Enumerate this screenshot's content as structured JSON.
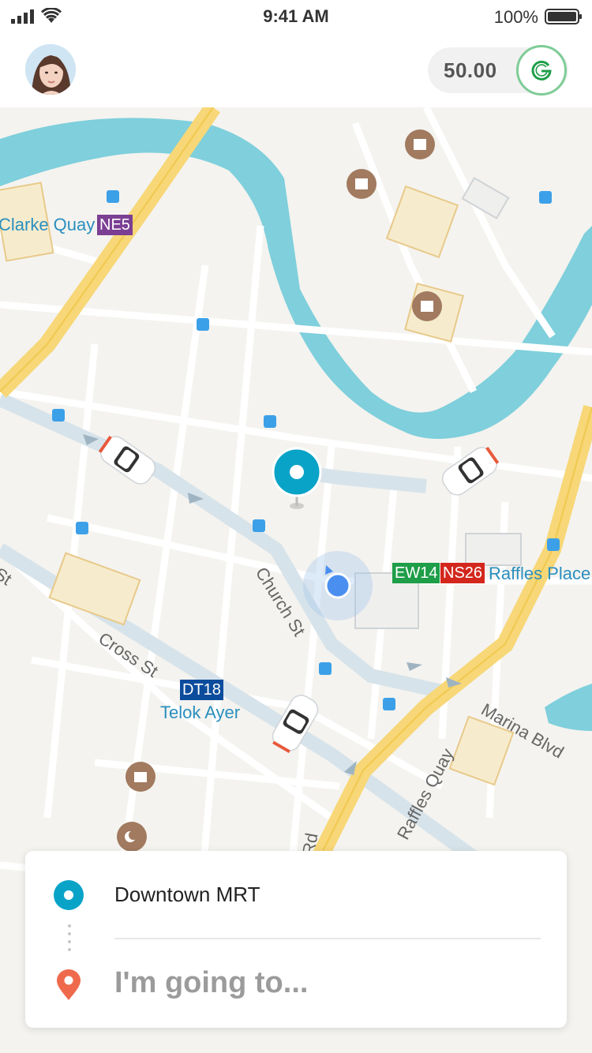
{
  "status_bar": {
    "time": "9:41 AM",
    "battery_percent": "100%"
  },
  "header": {
    "points_balance": "50.00"
  },
  "map": {
    "labels": {
      "clarke_quay": "Clarke Quay",
      "ne5": "NE5",
      "church_st": "Church St",
      "cross_st": "Cross St",
      "dt18": "DT18",
      "telok_ayer": "Telok Ayer",
      "ew14": "EW14",
      "ns26": "NS26",
      "raffles_place": "Raffles Place",
      "marina_blvd": "Marina Blvd",
      "raffles_quay": "Raffles Quay",
      "st_fragment": "St",
      "rd_fragment": "Rd"
    },
    "colors": {
      "water": "#7fcfdc",
      "road": "#ffffff",
      "highway": "#f7d777",
      "mrt_ne": "#7b3f93",
      "mrt_dt": "#0b4c9c",
      "mrt_ew": "#1e9e48",
      "mrt_ns": "#d3271d",
      "accent": "#0aa3c8"
    }
  },
  "trip_card": {
    "pickup_location": "Downtown MRT",
    "destination_placeholder": "I'm going to..."
  }
}
